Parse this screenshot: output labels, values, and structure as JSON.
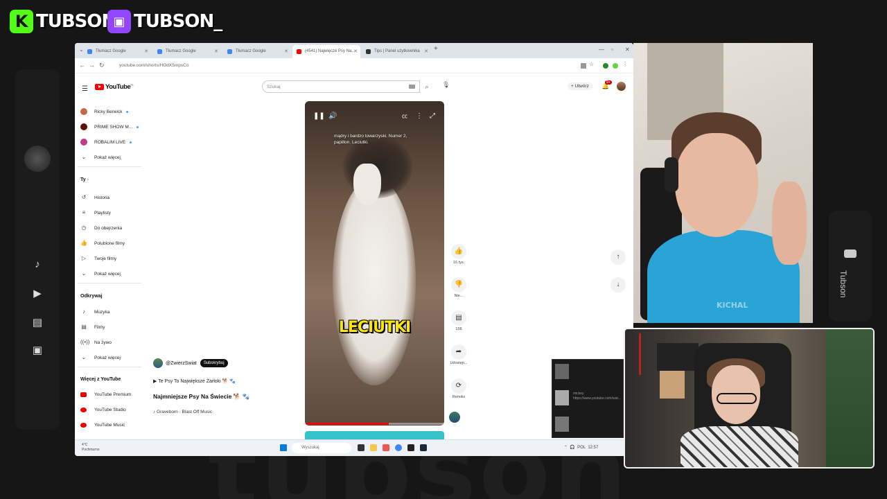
{
  "overlay": {
    "kick_name": "TUBSON",
    "twitch_name": "TUBSON_",
    "dock_right_label": "Tubson",
    "watermark": "tubson"
  },
  "browser": {
    "tabs": [
      {
        "label": "Tłumacz Google",
        "active": false
      },
      {
        "label": "Tłumacz Google",
        "active": false
      },
      {
        "label": "Tłumacz Google",
        "active": false
      },
      {
        "label": "(4541) Najwięcze Psy Na...",
        "active": true
      },
      {
        "label": "Tips | Panel użytkownika",
        "active": false
      }
    ],
    "url": "youtube.com/shorts/HOdX5mpsCo"
  },
  "youtube": {
    "logo": "YouTube",
    "logo_suffix": "PL",
    "search_placeholder": "Szukaj",
    "create_label": "Utwórz",
    "notif_count": "9+",
    "subscriptions": [
      {
        "name": "Ricky Berwick",
        "color": "#c06a4a"
      },
      {
        "name": "PRIME SHOW M...",
        "color": "#5a1010"
      },
      {
        "name": "ROBALIM LIVE",
        "color": "#c23a8a"
      }
    ],
    "show_more_1": "Pokaż więcej",
    "you_section": "Ty",
    "you_items": [
      {
        "label": "Historia",
        "icon": "history-icon"
      },
      {
        "label": "Playlisty",
        "icon": "playlist-icon"
      },
      {
        "label": "Do obejrzenia",
        "icon": "clock-icon"
      },
      {
        "label": "Polubione filmy",
        "icon": "thumbs-up-icon"
      },
      {
        "label": "Twoje filmy",
        "icon": "video-icon"
      }
    ],
    "show_more_2": "Pokaż więcej",
    "explore_section": "Odkrywaj",
    "explore_items": [
      {
        "label": "Muzyka",
        "icon": "music-icon"
      },
      {
        "label": "Filmy",
        "icon": "film-icon"
      },
      {
        "label": "Na żywo",
        "icon": "live-icon"
      }
    ],
    "show_more_3": "Pokaż więcej",
    "more_section": "Więcej z YouTube",
    "more_items": [
      {
        "label": "YouTube Premium"
      },
      {
        "label": "YouTube Studio"
      },
      {
        "label": "YouTube Music"
      }
    ]
  },
  "short": {
    "caption": "mądry i bardzo towarzyski. Numer 2, papillon. Leciutki.",
    "overlay_title": "LECIUTKI",
    "progress": 0.6,
    "likes": "16 tys.",
    "dislike_label": "Nie...",
    "comments": "158",
    "share_label": "Udostęp...",
    "remix_label": "Remiks",
    "channel": "@ZwierzSwiat",
    "subscribe_label": "Subskrybuj",
    "playlist": "Te Psy To Największe Żarłoki 🐕 🐾",
    "title": "Najmniejsze Psy Na Świecie 🐕 🐾",
    "music": "♪ Graveborn · Blast Off Music"
  },
  "taskbar": {
    "weather_temp": "4°C",
    "weather_desc": "Pochmurno",
    "search_placeholder": "Wyszukaj",
    "lang": "POL",
    "time": "12:57"
  },
  "chat": {
    "messages": [
      {
        "user": "",
        "text": ""
      },
      {
        "user": "mickey",
        "text": "https://www.youtube.com/wat..."
      },
      {
        "user": "",
        "text": ""
      }
    ]
  },
  "cam": {
    "watermark": "KICHAL"
  }
}
